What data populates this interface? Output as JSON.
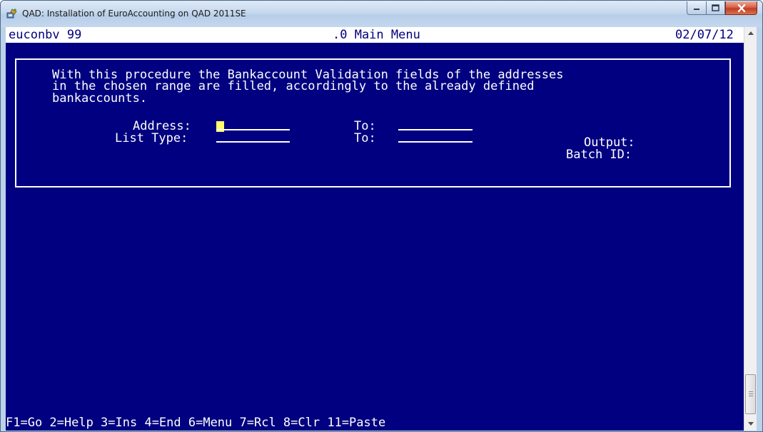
{
  "window": {
    "title": "QAD: Installation of EuroAccounting on QAD 2011SE",
    "controls": {
      "minimize_icon": "minimize-icon",
      "maximize_icon": "maximize-icon",
      "close_icon": "close-icon"
    }
  },
  "header": {
    "program": "euconbv 99",
    "menu": ".0 Main Menu",
    "date": "02/07/12"
  },
  "description": {
    "line1": "With this procedure the Bankaccount Validation fields of the addresses",
    "line2": "in the chosen range are filled, accordingly to the already defined",
    "line3": "bankaccounts."
  },
  "form": {
    "address_label": "Address:",
    "address_value": "",
    "address_to_label": "To:",
    "address_to_value": "",
    "list_type_label": "List Type:",
    "list_type_value": "",
    "list_type_to_label": "To:",
    "list_type_to_value": "",
    "output_label": "Output:",
    "batch_id_label": "Batch ID:"
  },
  "function_keys": "F1=Go 2=Help 3=Ins 4=End 6=Menu 7=Rcl 8=Clr 11=Paste",
  "colors": {
    "terminal_background": "#000080",
    "terminal_text": "#ffffff",
    "cursor": "#ffff66",
    "header_background": "#ffffff",
    "header_text": "#000080"
  }
}
